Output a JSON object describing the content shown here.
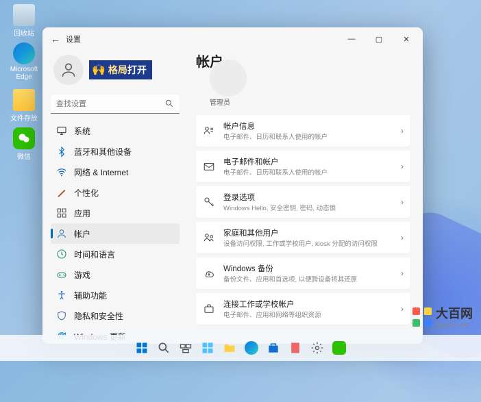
{
  "desktop": {
    "icons": [
      {
        "name": "recycle-bin",
        "label": "回收站"
      },
      {
        "name": "edge",
        "label": "Microsoft Edge"
      },
      {
        "name": "folder",
        "label": "文件存放"
      },
      {
        "name": "wechat",
        "label": "微信"
      }
    ]
  },
  "settings_window": {
    "back": "←",
    "title": "设置",
    "win_buttons": {
      "min": "—",
      "max": "▢",
      "close": "✕"
    },
    "profile": {
      "banner_prefix": "格局",
      "banner_suffix": "打开"
    },
    "search": {
      "placeholder": "查找设置"
    },
    "nav": [
      {
        "icon": "system",
        "label": "系统",
        "color": "#333"
      },
      {
        "icon": "bluetooth",
        "label": "蓝牙和其他设备",
        "color": "#0067c0"
      },
      {
        "icon": "network",
        "label": "网络 & Internet",
        "color": "#0067c0"
      },
      {
        "icon": "personalization",
        "label": "个性化",
        "color": "#b14f2c"
      },
      {
        "icon": "apps",
        "label": "应用",
        "color": "#555"
      },
      {
        "icon": "accounts",
        "label": "帐户",
        "color": "#3a7fbf",
        "active": true
      },
      {
        "icon": "time",
        "label": "时间和语言",
        "color": "#1f8f6f"
      },
      {
        "icon": "gaming",
        "label": "游戏",
        "color": "#2a8f5f"
      },
      {
        "icon": "accessibility",
        "label": "辅助功能",
        "color": "#2f6fcf"
      },
      {
        "icon": "privacy",
        "label": "隐私和安全性",
        "color": "#4a6fa0"
      },
      {
        "icon": "update",
        "label": "Windows 更新",
        "color": "#0f8fdf"
      }
    ],
    "page": {
      "title": "帐户",
      "role": "管理员",
      "cards": [
        {
          "icon": "account-info",
          "title": "帐户信息",
          "subtitle": "电子邮件、日历和联系人使用的帐户"
        },
        {
          "icon": "email",
          "title": "电子邮件和帐户",
          "subtitle": "电子邮件、日历和联系人使用的帐户"
        },
        {
          "icon": "signin",
          "title": "登录选项",
          "subtitle": "Windows Hello, 安全密钥, 密码, 动态锁"
        },
        {
          "icon": "family",
          "title": "家庭和其他用户",
          "subtitle": "设备访问权限, 工作或学校用户, kiosk 分配的访问权限"
        },
        {
          "icon": "backup",
          "title": "Windows 备份",
          "subtitle": "备份文件、应用和首选项, 以便跨设备将其还原"
        },
        {
          "icon": "work",
          "title": "连接工作或学校帐户",
          "subtitle": "电子邮件、应用和网络等组织资源"
        }
      ]
    }
  },
  "watermark": {
    "text": "大百网",
    "sub": "big100.net"
  }
}
